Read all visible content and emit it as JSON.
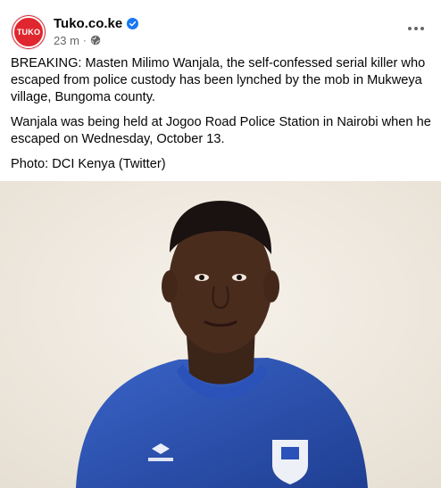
{
  "post": {
    "page_name": "Tuko.co.ke",
    "logo_text": "TUKO",
    "timestamp": "23 m",
    "separator": "·",
    "paragraphs": [
      "BREAKING: Masten Milimo Wanjala, the self-confessed serial killer who escaped from police custody has been lynched by the mob in Mukweya village, Bungoma county.",
      "Wanjala was being held at Jogoo Road Police Station in Nairobi when he escaped on Wednesday, October 13.",
      "Photo: DCI Kenya (Twitter)"
    ],
    "icons": {
      "verified": "verified-badge-icon",
      "audience": "globe-icon",
      "more": "more-options-icon"
    },
    "colors": {
      "brand": "#e0262e",
      "verified": "#1877f2",
      "meta_text": "#65676b",
      "shirt": "#2a52b8"
    }
  }
}
